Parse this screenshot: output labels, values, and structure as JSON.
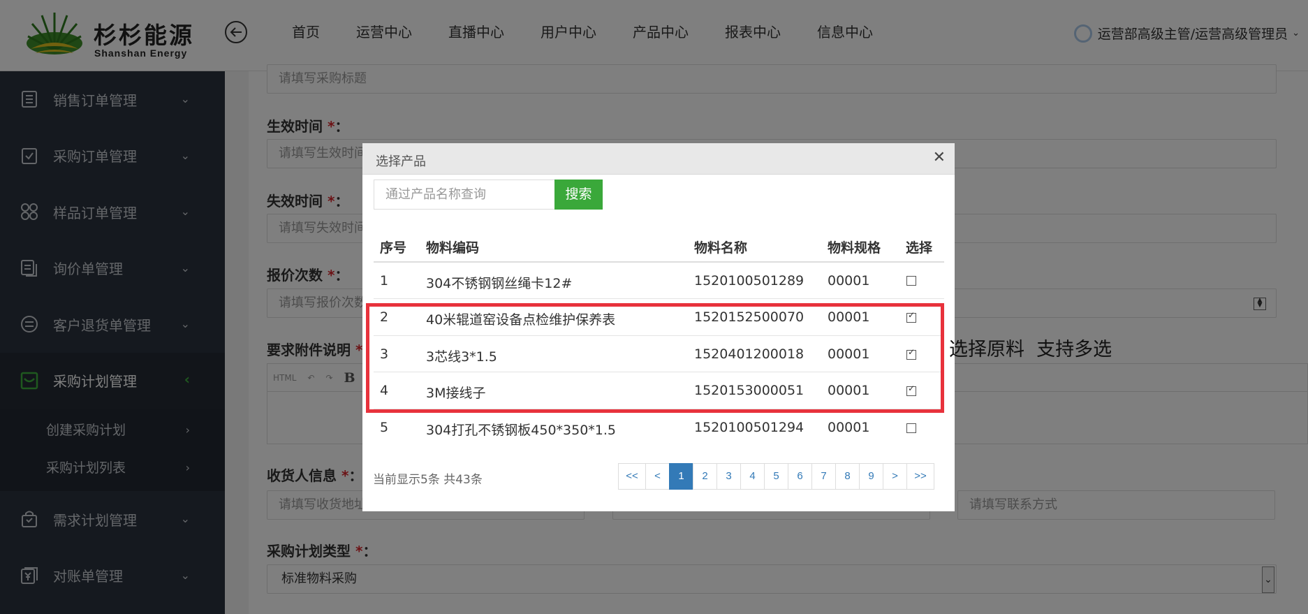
{
  "brand": {
    "name_cn": "杉杉能源",
    "name_en": "Shanshan Energy"
  },
  "nav": {
    "items": [
      {
        "label": "首页",
        "active": false
      },
      {
        "label": "运营中心",
        "active": true
      },
      {
        "label": "直播中心",
        "active": false
      },
      {
        "label": "用户中心",
        "active": false
      },
      {
        "label": "产品中心",
        "active": false
      },
      {
        "label": "报表中心",
        "active": false
      },
      {
        "label": "信息中心",
        "active": false
      }
    ],
    "user": "运营部高级主管/运营高级管理员",
    "accent": "#3a9b3a"
  },
  "sidebar": {
    "items": [
      {
        "label": "销售订单管理",
        "icon": "list-doc-icon"
      },
      {
        "label": "采购订单管理",
        "icon": "clipboard-check-icon"
      },
      {
        "label": "样品订单管理",
        "icon": "grid-circles-icon"
      },
      {
        "label": "询价单管理",
        "icon": "doc-copy-icon"
      },
      {
        "label": "客户退货单管理",
        "icon": "exchange-circle-icon"
      },
      {
        "label": "采购计划管理",
        "icon": "inbox-icon",
        "active": true
      },
      {
        "label": "需求计划管理",
        "icon": "bag-icon"
      },
      {
        "label": "对账单管理",
        "icon": "yen-doc-icon"
      }
    ],
    "sub_items": [
      {
        "label": "创建采购计划"
      },
      {
        "label": "采购计划列表"
      }
    ]
  },
  "form": {
    "title_placeholder": "请填写采购标题",
    "effective_label": "生效时间",
    "effective_placeholder": "请填写生效时间",
    "expire_label": "失效时间",
    "expire_placeholder": "请填写失效时间",
    "quote_label": "报价次数",
    "quote_placeholder": "请填写报价次数",
    "attach_label": "要求附件说明",
    "editor_html": "HTML",
    "editor_bold": "B",
    "receiver_label": "收货人信息",
    "receiver_placeholder": "请填写收货地址",
    "contact_placeholder": "请填写联系方式",
    "type_label": "采购计划类型",
    "type_value": "标准物料采购",
    "required_mark": "*",
    "colon": "："
  },
  "modal": {
    "title": "选择产品",
    "close": "✕",
    "search_placeholder": "通过产品名称查询",
    "search_button": "搜索",
    "columns": [
      "序号",
      "物料编码",
      "物料名称",
      "物料规格",
      "选择"
    ],
    "rows": [
      {
        "no": "1",
        "code": "304不锈钢钢丝绳卡12#",
        "name": "1520100501289",
        "spec": "00001",
        "checked": false
      },
      {
        "no": "2",
        "code": "40米辊道窑设备点检维护保养表",
        "name": "1520152500070",
        "spec": "00001",
        "checked": true
      },
      {
        "no": "3",
        "code": "3芯线3*1.5",
        "name": "1520401200018",
        "spec": "00001",
        "checked": true
      },
      {
        "no": "4",
        "code": "3M接线子",
        "name": "1520153000051",
        "spec": "00001",
        "checked": true
      },
      {
        "no": "5",
        "code": "304打孔不锈钢板450*350*1.5",
        "name": "1520100501294",
        "spec": "00001",
        "checked": false
      }
    ],
    "info": "当前显示5条 共43条",
    "pages": [
      "<<",
      "<",
      "1",
      "2",
      "3",
      "4",
      "5",
      "6",
      "7",
      "8",
      "9",
      ">",
      ">>"
    ],
    "current_page": "1"
  },
  "annotation": {
    "text": "选择原料  支持多选",
    "color": "#e8323c"
  }
}
